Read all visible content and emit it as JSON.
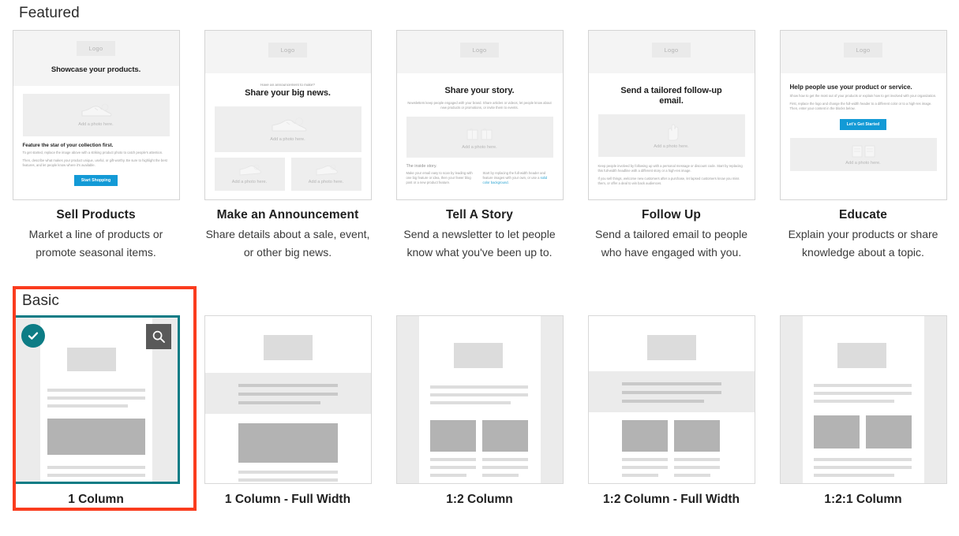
{
  "sections": {
    "featured": {
      "title": "Featured"
    },
    "basic": {
      "title": "Basic"
    }
  },
  "colors": {
    "selection_teal": "#0d7c85",
    "annotation_red": "#fa3c1e",
    "cta_blue": "#139ad6",
    "zoom_button_gray": "#595959"
  },
  "featured": [
    {
      "title": "Sell Products",
      "description": "Market a line of products or promote seasonal items.",
      "preview": {
        "logo": "Logo",
        "headline": "Showcase your products.",
        "photo_caption": "Add a photo here.",
        "sub": "Feature the star of your collection first.",
        "para1": "To get started, replace the image above with a striking product photo to catch people's attention.",
        "para2": "Then, describe what makes your product unique, useful, or gift-worthy. Be sure to highlight the best features, and let people know where it's available.",
        "button": "Start Shopping"
      }
    },
    {
      "title": "Make an Announcement",
      "description": "Share details about a sale, event, or other big news.",
      "preview": {
        "logo": "Logo",
        "eyebrow": "Have an announcement to make?",
        "headline": "Share your big news.",
        "photo_caption": "Add a photo here.",
        "photo_caption_left": "Add a photo here.",
        "photo_caption_right": "Add a photo here."
      }
    },
    {
      "title": "Tell A Story",
      "description": "Send a newsletter to let people know what you've been up to.",
      "preview": {
        "logo": "Logo",
        "headline": "Share your story.",
        "intro": "Newsletters keep people engaged with your brand. Share articles or videos, let people know about new products or promotions, or invite them to events.",
        "photo_caption": "Add a photo here.",
        "sub": "The inside story.",
        "col_left": "Make your email easy to scan by leading with one big feature or idea, then your fewer blog post or a new product feature.",
        "col_right": "Start by replacing the full-width header and feature images with your own, or use a",
        "col_right_link": "solid color background."
      }
    },
    {
      "title": "Follow Up",
      "description": "Send a tailored email to people who have engaged with you.",
      "preview": {
        "logo": "Logo",
        "headline": "Send a tailored follow-up email.",
        "photo_caption": "Add a photo here.",
        "para1": "Keep people involved by following up with a personal message or discount code. Start by replacing this full-width headline with a different story or a high-res image.",
        "para2": "If you sell things, welcome new customers after a purchase, let lapsed customers know you miss them, or offer a deal to win back audiences."
      }
    },
    {
      "title": "Educate",
      "description": "Explain your products or share knowledge about a topic.",
      "preview": {
        "logo": "Logo",
        "headline": "Help people use your product or service.",
        "para1": "Show how to get the most out of your products or explain how to get involved with your organization.",
        "para2": "First, replace the logo and change the full-width header to a different color or to a high-res image. Then, enter your content in the blocks below.",
        "button": "Let's Get Started",
        "photo_caption": "Add a photo here."
      }
    }
  ],
  "basic": [
    {
      "label": "1 Column",
      "selected": true,
      "layout": "one-column"
    },
    {
      "label": "1 Column - Full Width",
      "selected": false,
      "layout": "one-column-full-width"
    },
    {
      "label": "1:2 Column",
      "selected": false,
      "layout": "one-two-column"
    },
    {
      "label": "1:2 Column - Full Width",
      "selected": false,
      "layout": "one-two-column-full-width"
    },
    {
      "label": "1:2:1 Column",
      "selected": false,
      "layout": "one-two-one-column"
    }
  ],
  "selected_card": {
    "check_icon": "check-icon",
    "zoom_icon": "magnifier-icon"
  }
}
